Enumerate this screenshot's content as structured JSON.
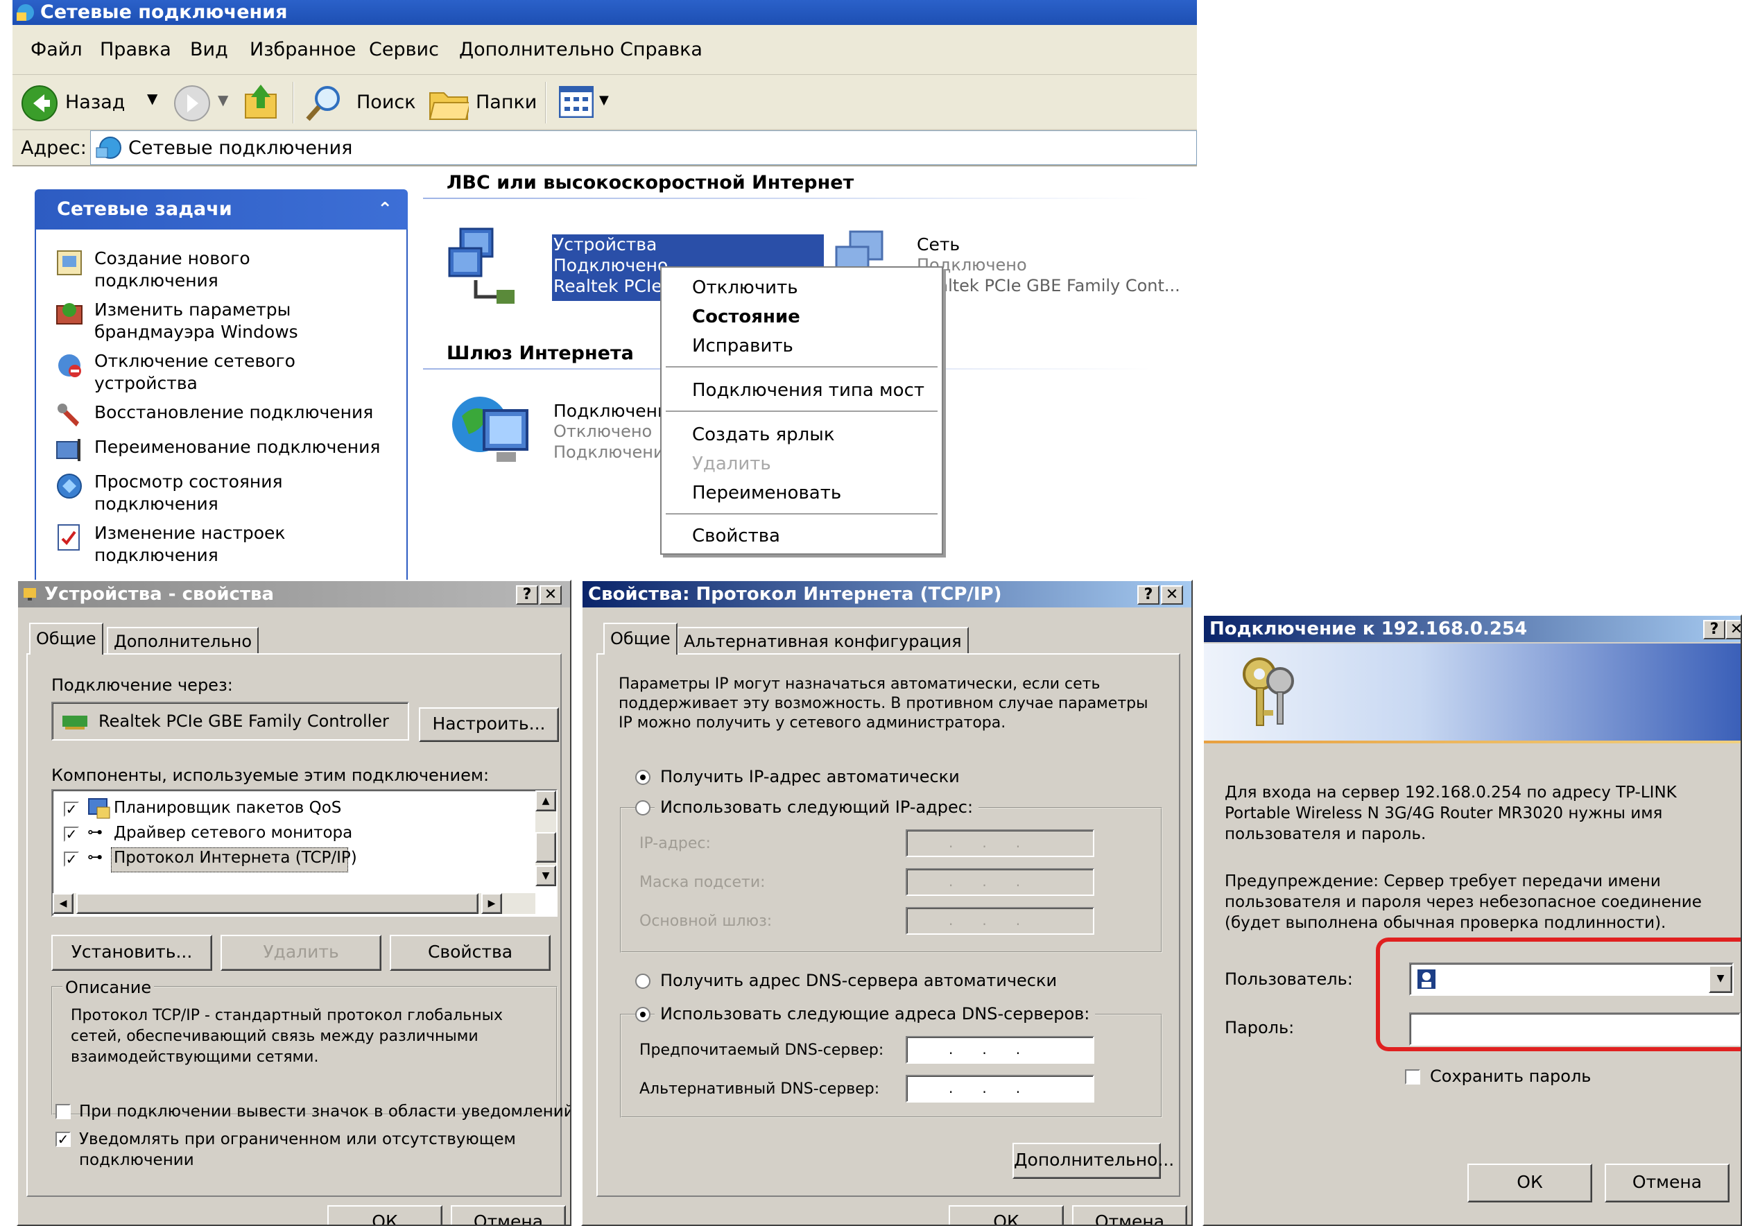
{
  "explorer": {
    "title": "Сетевые подключения",
    "menu": [
      "Файл",
      "Правка",
      "Вид",
      "Избранное",
      "Сервис",
      "Дополнительно",
      "Справка"
    ],
    "toolbar": {
      "back": "Назад",
      "search": "Поиск",
      "folders": "Папки"
    },
    "address": {
      "label": "Адрес:",
      "value": "Сетевые подключения"
    },
    "tasks": {
      "header": "Сетевые задачи",
      "items": [
        [
          "Создание нового",
          "подключения"
        ],
        [
          "Изменить параметры",
          "брандмауэра Windows"
        ],
        [
          "Отключение сетевого",
          "устройства"
        ],
        [
          "Восстановление подключения"
        ],
        [
          "Переименование подключения"
        ],
        [
          "Просмотр состояния",
          "подключения"
        ],
        [
          "Изменение настроек",
          "подключения"
        ]
      ]
    },
    "lan_section": "ЛВС или высокоскоростной Интернет",
    "gateway_section": "Шлюз Интернета",
    "connections": {
      "devices": {
        "name": "Устройства",
        "status": "Подключено",
        "adapter": "Realtek PCIe"
      },
      "network": {
        "name": "Сеть",
        "status": "Подключено",
        "adapter": "Realtek PCIe GBE Family Cont..."
      },
      "gateway": {
        "name": "Подключение",
        "status": "Отключено",
        "type": "Подключение"
      }
    },
    "context_menu": [
      "Отключить",
      "Состояние",
      "Исправить",
      "Подключения типа мост",
      "Создать ярлык",
      "Удалить",
      "Переименовать",
      "Свойства"
    ]
  },
  "props": {
    "title": "Устройства - свойства",
    "tabs": [
      "Общие",
      "Дополнительно"
    ],
    "connect_via_label": "Подключение через:",
    "adapter": "Realtek PCIe GBE Family Controller",
    "configure": "Настроить...",
    "components_label": "Компоненты, используемые этим подключением:",
    "components": [
      "Планировщик пакетов QoS",
      "Драйвер сетевого монитора",
      "Протокол Интернета (TCP/IP)"
    ],
    "install": "Установить...",
    "remove": "Удалить",
    "properties": "Свойства",
    "desc_title": "Описание",
    "desc": [
      "Протокол TCP/IP - стандартный протокол глобальных",
      "сетей, обеспечивающий связь между различными",
      "взаимодействующими сетями."
    ],
    "show_icon": "При подключении вывести значок в области уведомлений",
    "notify": [
      "Уведомлять при ограниченном или отсутствующем",
      "подключении"
    ],
    "ok": "ОК",
    "cancel": "Отмена"
  },
  "tcpip": {
    "title": "Свойства: Протокол Интернета (TCP/IP)",
    "tabs": [
      "Общие",
      "Альтернативная конфигурация"
    ],
    "intro": [
      "Параметры IP могут назначаться автоматически, если сеть",
      "поддерживает эту возможность. В противном случае параметры",
      "IP можно получить у сетевого администратора."
    ],
    "auto_ip": "Получить IP-адрес автоматически",
    "manual_ip": "Использовать следующий IP-адрес:",
    "ip": "IP-адрес:",
    "mask": "Маска подсети:",
    "gateway": "Основной шлюз:",
    "auto_dns": "Получить адрес DNS-сервера автоматически",
    "manual_dns": "Использовать следующие адреса DNS-серверов:",
    "pref_dns": "Предпочитаемый DNS-сервер:",
    "alt_dns": "Альтернативный DNS-сервер:",
    "advanced": "Дополнительно...",
    "ok": "ОК",
    "cancel": "Отмена"
  },
  "login": {
    "title": "Подключение к 192.168.0.254",
    "msg": [
      "Для входа на сервер 192.168.0.254 по адресу TP-LINK",
      "Portable Wireless N 3G/4G Router MR3020 нужны имя",
      "пользователя и пароль."
    ],
    "warning": [
      "Предупреждение: Сервер требует передачи имени",
      "пользователя и пароля через небезопасное соединение",
      "(будет выполнена обычная проверка подлинности)."
    ],
    "user": "Пользователь:",
    "password": "Пароль:",
    "save": "Сохранить пароль",
    "ok": "ОК",
    "cancel": "Отмена",
    "highlight_color": "#e02020"
  },
  "colors": {
    "xp_title": "#1d4fb3",
    "selection": "#2a4fa8",
    "dialog_bg": "#d4d0c8"
  }
}
